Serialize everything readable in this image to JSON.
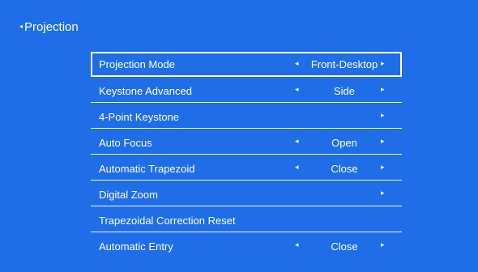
{
  "header": {
    "back_glyph": "◂",
    "title": "Projection"
  },
  "menu": [
    {
      "label": "Projection Mode",
      "value": "Front-Desktop",
      "left": "◂",
      "right": "▸"
    },
    {
      "label": "Keystone Advanced",
      "value": "Side",
      "left": "◂",
      "right": "▸"
    },
    {
      "label": "4-Point Keystone",
      "value": "",
      "left": "",
      "right": "▸"
    },
    {
      "label": "Auto Focus",
      "value": "Open",
      "left": "◂",
      "right": "▸"
    },
    {
      "label": "Automatic Trapezoid",
      "value": "Close",
      "left": "◂",
      "right": "▸"
    },
    {
      "label": "Digital Zoom",
      "value": "",
      "left": "",
      "right": "▸"
    },
    {
      "label": "Trapezoidal Correction Reset",
      "value": "",
      "left": "",
      "right": ""
    },
    {
      "label": "Automatic Entry",
      "value": "Close",
      "left": "◂",
      "right": "▸"
    }
  ],
  "colors": {
    "background": "#1f6ee8",
    "text": "#ffffff"
  }
}
